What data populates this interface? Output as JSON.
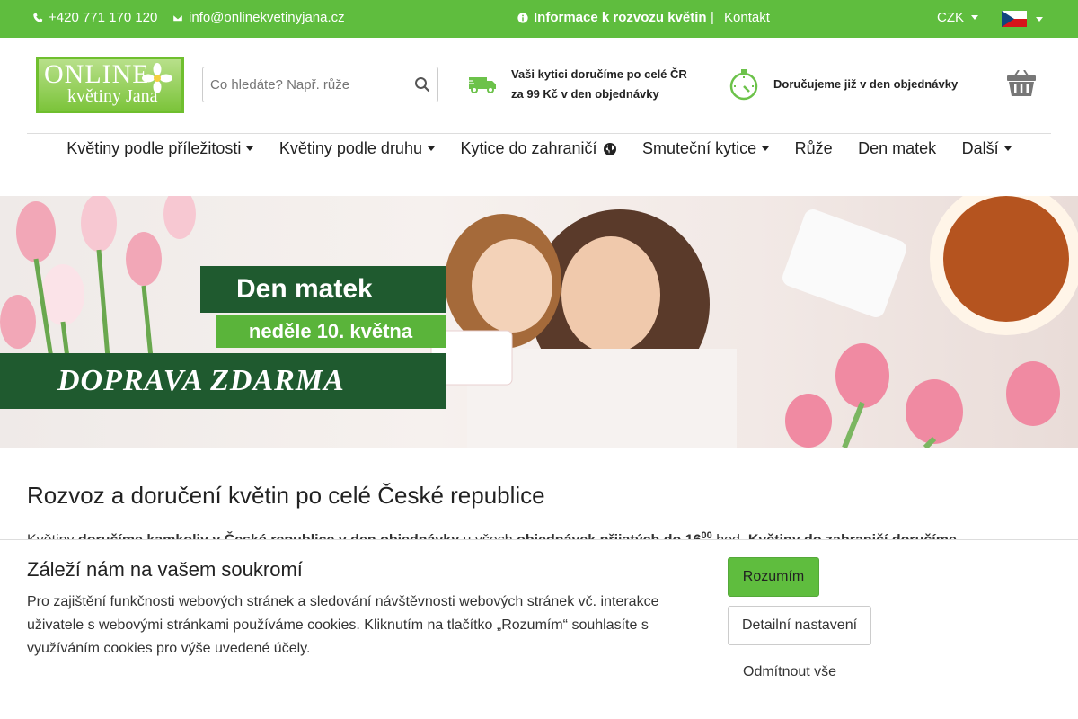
{
  "topbar": {
    "phone": "+420 771 170 120",
    "email": "info@onlinekvetinyjana.cz",
    "delivery_info": "Informace k rozvozu květin",
    "separator": "|",
    "contact": "Kontakt",
    "currency": "CZK",
    "flag": "czech-flag"
  },
  "logo": {
    "line1": "ONLINE",
    "line2": "květiny Jana"
  },
  "search": {
    "placeholder": "Co hledáte? Např. růže"
  },
  "usp": {
    "delivery_line1": "Vaši kytici doručíme po celé ČR",
    "delivery_line2": "za 99 Kč v den objednávky",
    "sameday": "Doručujeme již v den objednávky"
  },
  "nav": {
    "items": [
      {
        "label": "Květiny podle příležitosti",
        "dropdown": true
      },
      {
        "label": "Květiny podle druhu",
        "dropdown": true
      },
      {
        "label": "Kytice do zahraničí",
        "dropdown": false
      },
      {
        "label": "Smuteční kytice",
        "dropdown": true
      },
      {
        "label": "Růže",
        "dropdown": false
      },
      {
        "label": "Den matek",
        "dropdown": false
      },
      {
        "label": "Další",
        "dropdown": true
      }
    ]
  },
  "banner": {
    "title": "Den matek",
    "date": "neděle 10. května",
    "free_shipping": "DOPRAVA ZDARMA"
  },
  "content": {
    "title": "Rozvoz a doručení květin po celé České republice",
    "para_p1": "Květiny ",
    "para_b1": "doručíme kamkoliv v České republice v den objednávky",
    "para_p2": " u všech ",
    "para_b2": "objednávek přijatých do 16",
    "para_sup": "00",
    "para_p3": " hod. ",
    "para_b3": "Květiny do zahraničí doručíme"
  },
  "cookie": {
    "title": "Záleží nám na vašem soukromí",
    "text": "Pro zajištění funkčnosti webových stránek a sledování návštěvnosti webových stránek vč. interakce uživatele s webovými stránkami používáme cookies. Kliknutím na tlačítko „Rozumím“ souhlasíte s využíváním cookies pro výše uvedené účely.",
    "accept": "Rozumím",
    "settings": "Detailní nastavení",
    "reject": "Odmítnout vše"
  },
  "colors": {
    "brand_green": "#5fbd3e",
    "dark_green": "#1f5a2f"
  }
}
